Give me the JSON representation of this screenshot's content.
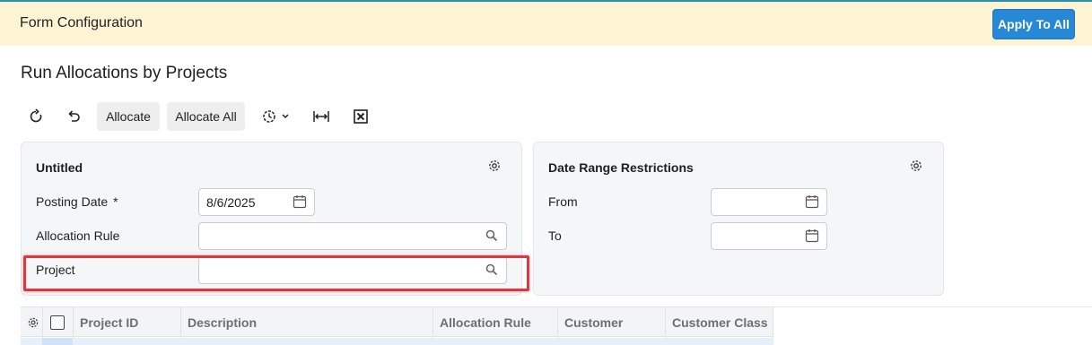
{
  "banner": {
    "title": "Form Configuration",
    "apply_label": "Apply To All"
  },
  "page": {
    "title": "Run Allocations by Projects"
  },
  "toolbar": {
    "refresh_icon": "refresh-icon",
    "undo_icon": "undo-icon",
    "allocate_label": "Allocate",
    "allocate_all_label": "Allocate All",
    "schedule_icon": "schedule-icon",
    "fit_icon": "fit-width-icon",
    "excel_icon": "excel-export-icon"
  },
  "panel_left": {
    "title": "Untitled",
    "posting_date_label": "Posting Date",
    "required_mark": "*",
    "posting_date_value": "8/6/2025",
    "allocation_rule_label": "Allocation Rule",
    "allocation_rule_value": "",
    "project_label": "Project",
    "project_value": ""
  },
  "panel_right": {
    "title": "Date Range Restrictions",
    "from_label": "From",
    "from_value": "",
    "to_label": "To",
    "to_value": ""
  },
  "grid": {
    "columns": [
      "Project ID",
      "Description",
      "Allocation Rule",
      "Customer",
      "Customer Class"
    ]
  },
  "colors": {
    "accent": "#2788d6",
    "banner_bg": "#fdf4d3",
    "highlight": "#d9393f"
  }
}
